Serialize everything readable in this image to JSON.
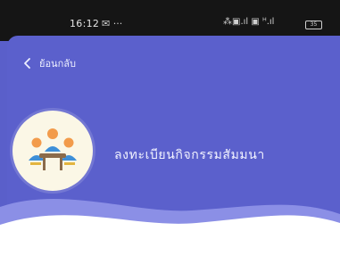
{
  "status_bar": {
    "time": "16:12",
    "left_icons": "✉ ···",
    "right_icons": "⁂▣.ıl ▣ ᴴ.ıl",
    "battery": "35"
  },
  "header": {
    "back_label": "ย้อนกลับ",
    "title": "ลงทะเบียนกิจกรรมสัมมนา",
    "avatar_icon": "meeting-people-icon"
  },
  "colors": {
    "header_bg": "#5b60cc",
    "wave_light": "#8b8fe6",
    "content_bg": "#ffffff",
    "avatar_bg": "#fbf7e6"
  }
}
